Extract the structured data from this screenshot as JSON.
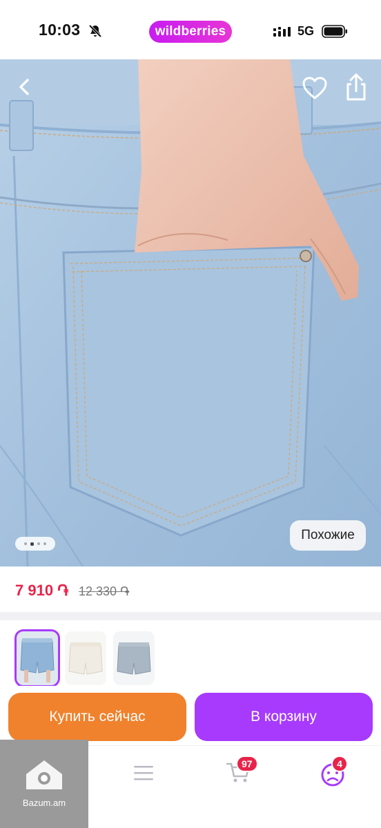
{
  "status_bar": {
    "time": "10:03",
    "app_brand": "wildberries",
    "network": "5G"
  },
  "gallery": {
    "similar_label": "Похожие",
    "page_count": 4,
    "active_page": 2,
    "icons": [
      "back-icon",
      "heart-icon",
      "share-icon"
    ]
  },
  "price": {
    "current": "7 910 ֏",
    "old": "12 330 ֏"
  },
  "variants": {
    "items": [
      {
        "name": "light-blue-denim-shorts",
        "selected": true
      },
      {
        "name": "white-denim-shorts",
        "selected": false
      },
      {
        "name": "grey-denim-shorts",
        "selected": false
      }
    ]
  },
  "actions": {
    "buy_now": "Купить сейчас",
    "add_to_cart": "В корзину"
  },
  "bottom_nav": {
    "cart_badge": "97",
    "profile_badge": "4",
    "icons": [
      "home-icon",
      "menu-icon",
      "cart-icon",
      "profile-icon"
    ]
  },
  "watermark": {
    "text": "Bazum.am"
  },
  "colors": {
    "brand": "#cb11ab",
    "buy_now": "#f0822d",
    "add_to_cart": "#a73afd",
    "price": "#e8234a",
    "badge": "#e8234a"
  }
}
